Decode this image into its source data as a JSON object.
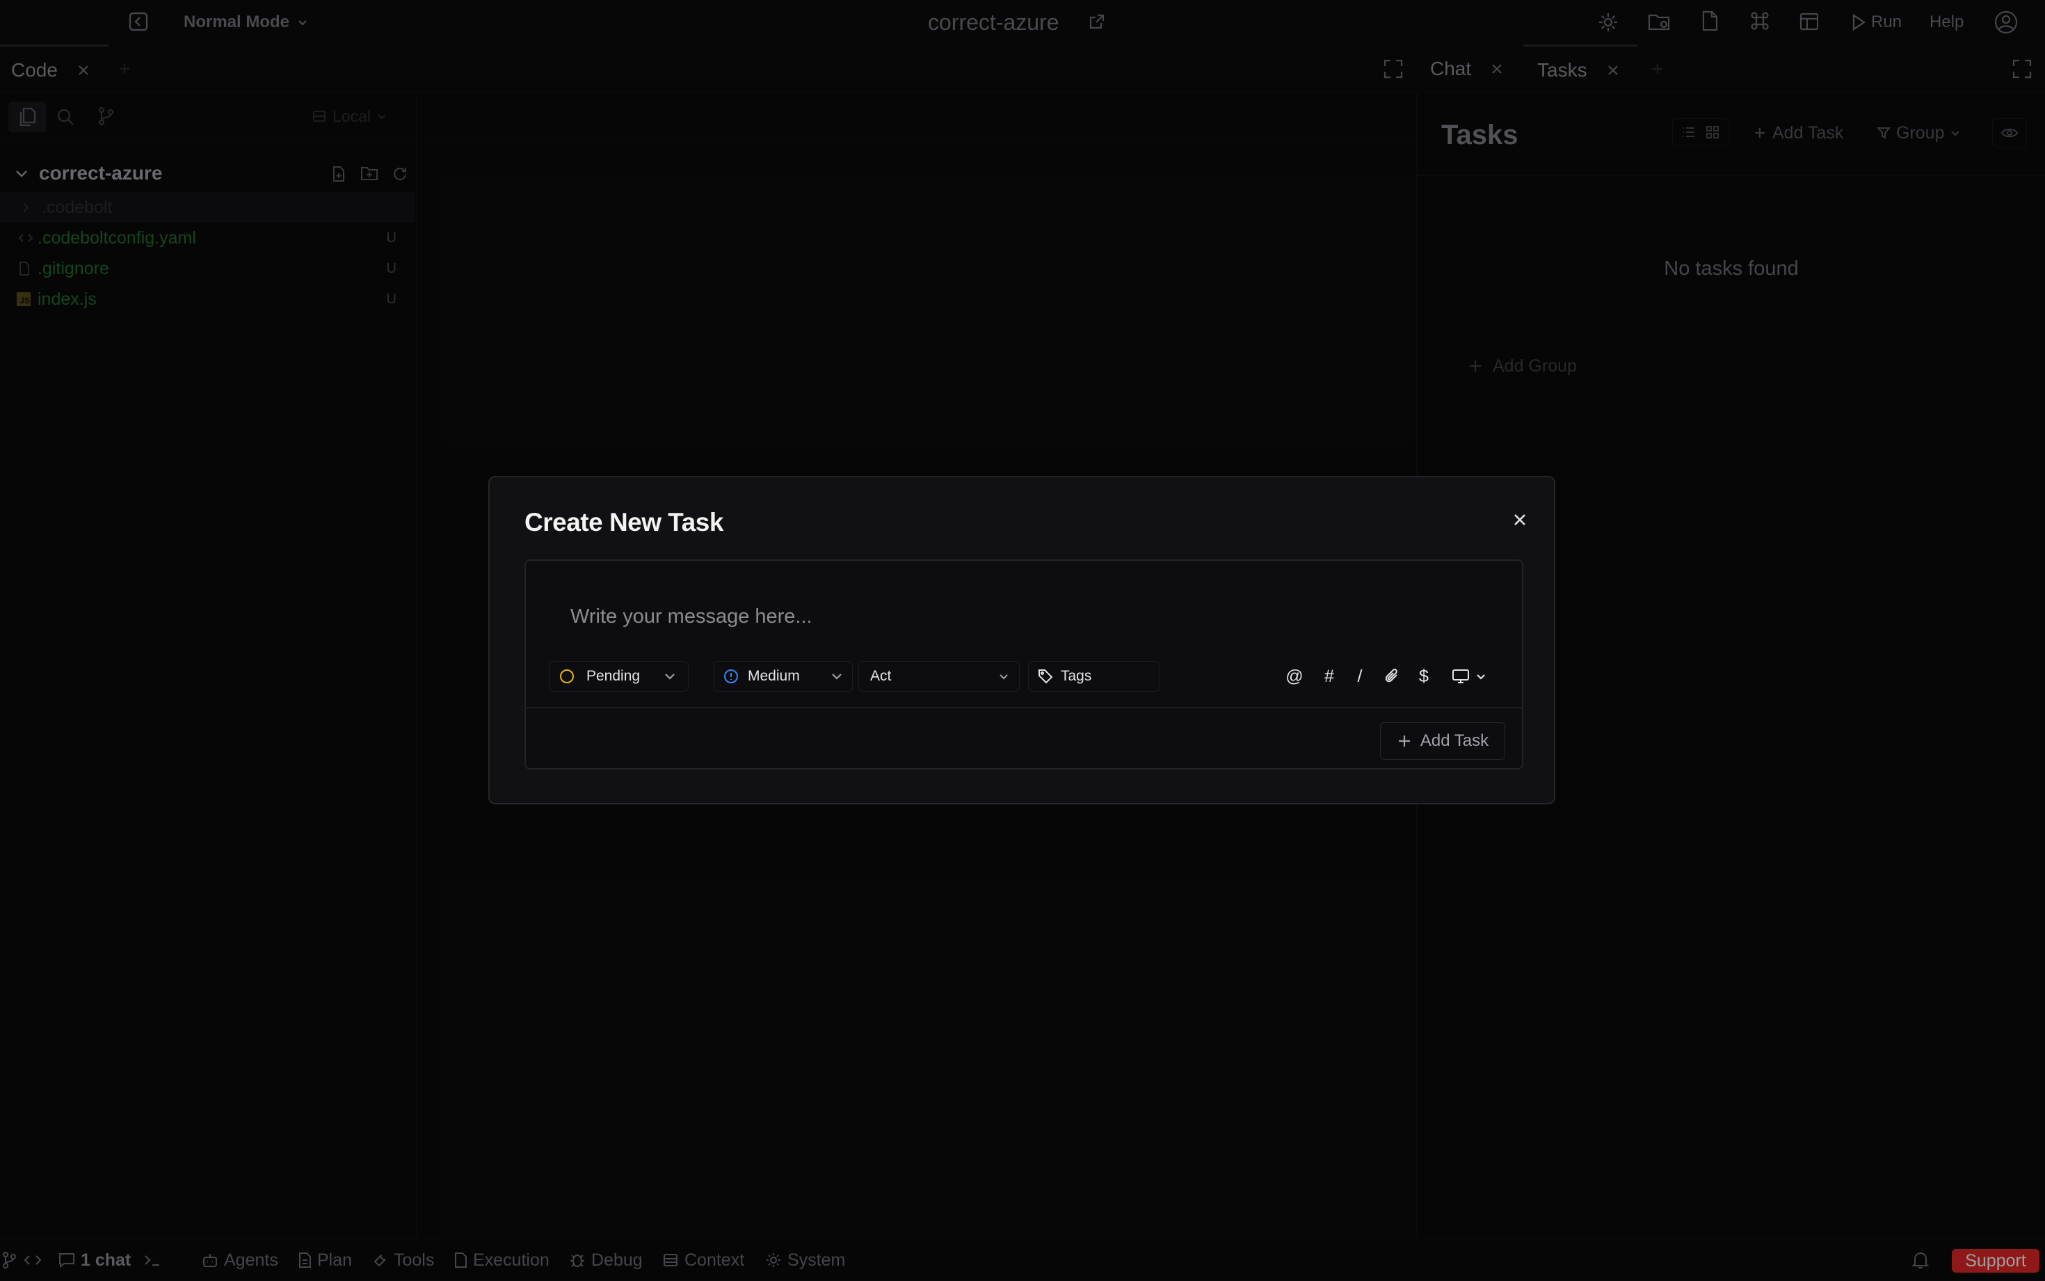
{
  "topbar": {
    "mode_label": "Normal Mode",
    "project_title": "correct-azure",
    "run_label": "Run",
    "help_label": "Help"
  },
  "left_tabs": {
    "tabs": [
      {
        "label": "Code"
      }
    ]
  },
  "right_tabs": {
    "tabs": [
      {
        "label": "Chat"
      },
      {
        "label": "Tasks"
      }
    ]
  },
  "explorer": {
    "branch_label": "Local",
    "root_folder": "correct-azure",
    "items": [
      {
        "name": ".codebolt",
        "type": "folder",
        "status": ""
      },
      {
        "name": ".codeboltconfig.yaml",
        "type": "yaml",
        "status": "U"
      },
      {
        "name": ".gitignore",
        "type": "file",
        "status": "U"
      },
      {
        "name": "index.js",
        "type": "js",
        "status": "U"
      }
    ]
  },
  "tasks_panel": {
    "title": "Tasks",
    "add_task_label": "Add Task",
    "group_label": "Group",
    "empty_message": "No tasks found",
    "add_group_label": "Add Group"
  },
  "modal": {
    "title": "Create New Task",
    "message_placeholder": "Write your message here...",
    "message_value": "",
    "status_value": "Pending",
    "priority_value": "Medium",
    "mode_value": "Act",
    "tags_label": "Tags",
    "tools": [
      "@",
      "#",
      "/",
      "attachment-icon",
      "$",
      "monitor-icon"
    ],
    "submit_label": "Add Task"
  },
  "statusbar": {
    "chat_count_label": "1 chat",
    "items": [
      {
        "label": "Agents",
        "icon": "agents-icon"
      },
      {
        "label": "Plan",
        "icon": "plan-icon"
      },
      {
        "label": "Tools",
        "icon": "tools-icon"
      },
      {
        "label": "Execution",
        "icon": "execution-icon"
      },
      {
        "label": "Debug",
        "icon": "debug-icon"
      },
      {
        "label": "Context",
        "icon": "context-icon"
      },
      {
        "label": "System",
        "icon": "system-icon"
      }
    ],
    "support_label": "Support"
  },
  "colors": {
    "background": "#0a0a0b",
    "modal_bg": "#111113",
    "pending_status": "#eab308",
    "medium_priority": "#3b82f6",
    "file_untracked": "#22c55e",
    "support_badge": "#dc2626"
  }
}
